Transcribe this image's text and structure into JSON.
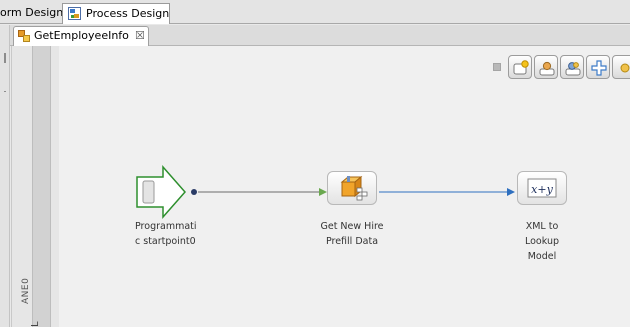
{
  "outer_tabs": {
    "form_design_label": "orm Design",
    "process_design_label": "Process Design"
  },
  "editor_tab": {
    "label": "GetEmployeeInfo",
    "close_glyph": "☒"
  },
  "lane": {
    "label": "ANE0",
    "partial_label": "L"
  },
  "toolbar": {
    "buttons": [
      "new-activity-icon",
      "user-icon",
      "assign-task-icon",
      "add-icon",
      "more-icon"
    ]
  },
  "process": {
    "start": {
      "label_line1": "Programmati",
      "label_line2": "c startpoint0"
    },
    "step1": {
      "label_line1": "Get New Hire",
      "label_line2": "Prefill Data"
    },
    "step2": {
      "label_line1": "XML to",
      "label_line2": "Lookup",
      "label_line3": "Model",
      "icon_text": "x+y"
    }
  },
  "colors": {
    "start_arrow": "#2e8f2e",
    "connector_green": "#6aa84f",
    "connector_blue": "#2e6fbf",
    "canvas_bg": "#f0f0f0"
  }
}
